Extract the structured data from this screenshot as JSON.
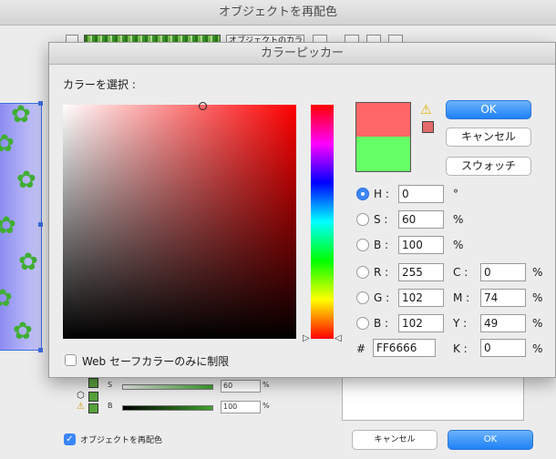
{
  "background_window": {
    "title": "オブジェクトを再配色",
    "toolbar_label": "オブジェクトのカラー",
    "sliders": [
      {
        "letter": "S",
        "value": "60",
        "unit": "%"
      },
      {
        "letter": "B",
        "value": "100",
        "unit": "%"
      }
    ],
    "recolor_checkbox_label": "オブジェクトを再配色",
    "cancel_label": "キャンセル",
    "ok_label": "OK"
  },
  "picker": {
    "title": "カラーピッカー",
    "prompt": "カラーを選択 :",
    "web_safe_label": "Web セーフカラーのみに制限",
    "ok_label": "OK",
    "cancel_label": "キャンセル",
    "swatch_label": "スウォッチ",
    "new_color": "#ff6666",
    "original_color": "#66ff66",
    "hsb": {
      "h_label": "H :",
      "h_value": "0",
      "h_unit": "°",
      "s_label": "S :",
      "s_value": "60",
      "s_unit": "%",
      "b_label": "B :",
      "b_value": "100",
      "b_unit": "%"
    },
    "rgb": {
      "r_label": "R :",
      "r_value": "255",
      "g_label": "G :",
      "g_value": "102",
      "b_label": "B :",
      "b_value": "102"
    },
    "cmyk": {
      "c_label": "C :",
      "c_value": "0",
      "c_unit": "%",
      "m_label": "M :",
      "m_value": "74",
      "m_unit": "%",
      "y_label": "Y :",
      "y_value": "49",
      "y_unit": "%",
      "k_label": "K :",
      "k_value": "0",
      "k_unit": "%"
    },
    "hex_label": "#",
    "hex_value": "FF6666"
  }
}
